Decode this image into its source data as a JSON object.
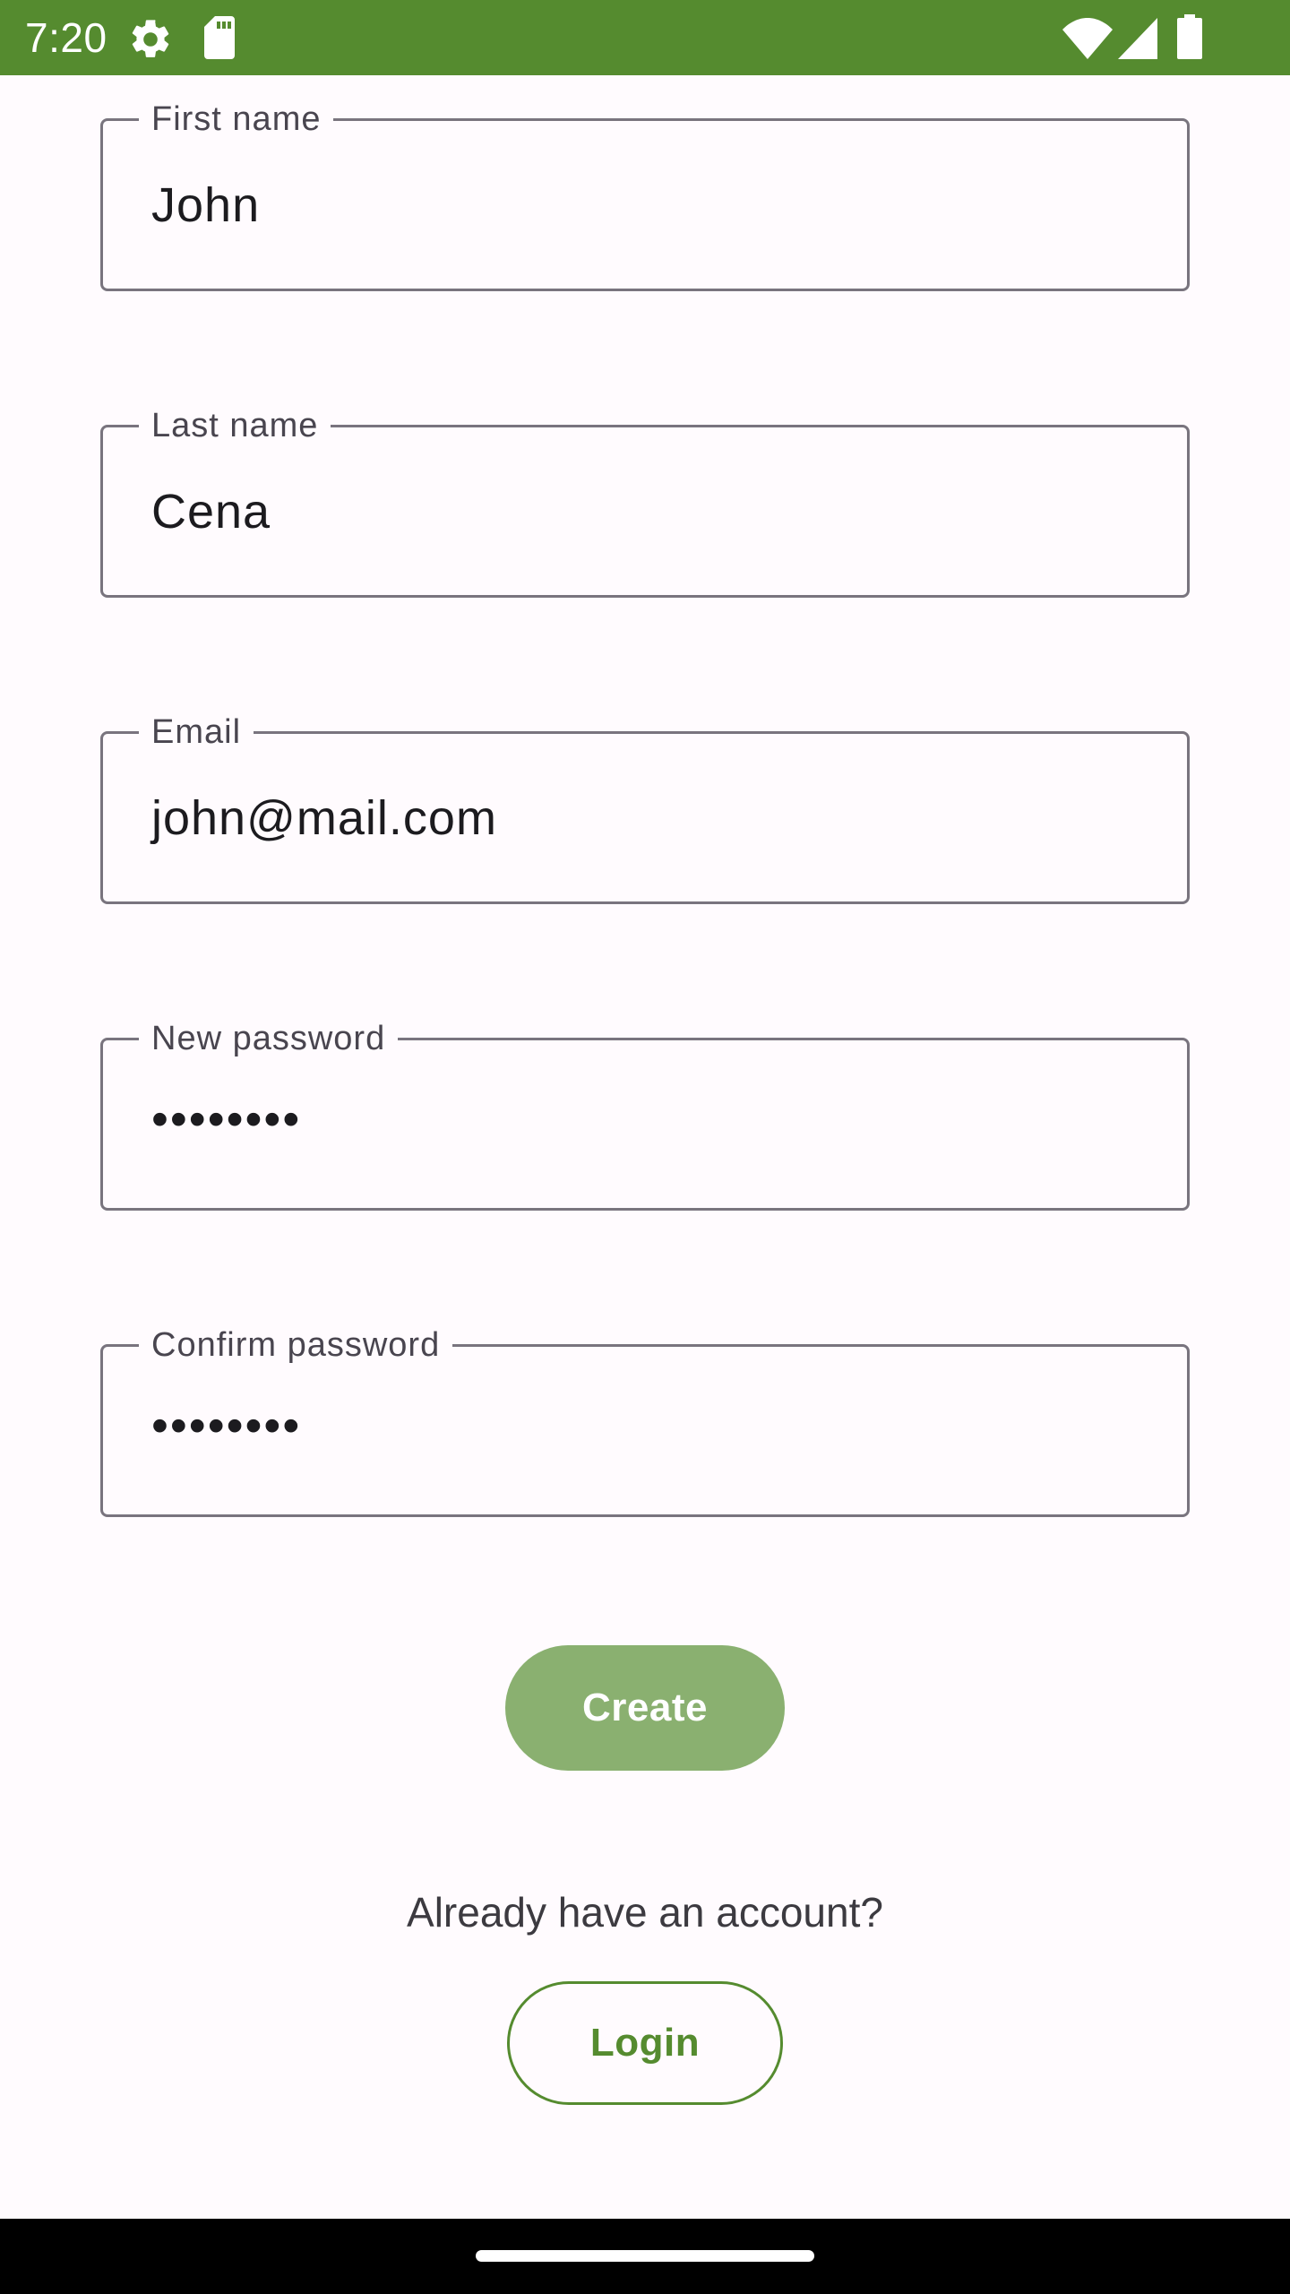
{
  "status_bar": {
    "time": "7:20",
    "icons": [
      "settings-gear-icon",
      "sd-card-icon",
      "wifi-icon",
      "cellular-signal-icon",
      "battery-icon"
    ],
    "background_color": "#558b2f"
  },
  "form": {
    "first_name": {
      "label": "First name",
      "value": "John"
    },
    "last_name": {
      "label": "Last name",
      "value": "Cena"
    },
    "email": {
      "label": "Email",
      "value": "john@mail.com"
    },
    "new_password": {
      "label": "New password",
      "value": "••••••••"
    },
    "confirm_password": {
      "label": "Confirm password",
      "value": "••••••••"
    }
  },
  "actions": {
    "create_label": "Create",
    "already_text": "Already have an account?",
    "login_label": "Login"
  },
  "colors": {
    "primary": "#558b2f",
    "create_button": "#8ab070",
    "background": "#fffbfe",
    "outline": "#79747e"
  }
}
